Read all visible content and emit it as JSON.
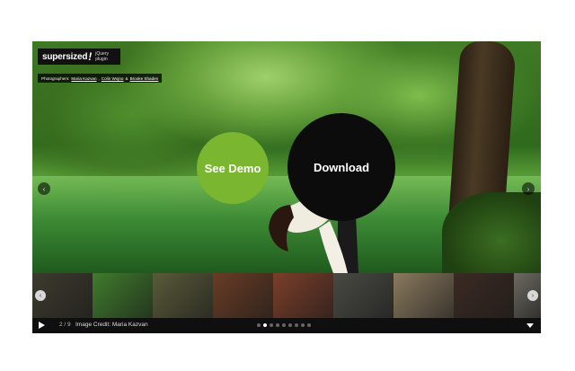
{
  "logo": {
    "name": "supersized",
    "mark": "!",
    "tagline": "jQuery plugin"
  },
  "credits": {
    "prefix": "Photographers:",
    "names": [
      "Maria Kazvan",
      "Colin Wojno",
      "Brooke Shaden"
    ],
    "sep1": ",",
    "sep2": "&"
  },
  "buttons": {
    "demo": "See Demo",
    "download": "Download"
  },
  "arrows": {
    "prev": "‹",
    "next": "›"
  },
  "slides": {
    "current": 2,
    "total": 9,
    "counter": "2 / 9",
    "credit_text": "Image Credit: Maria Kazvan"
  },
  "thumbnails": [
    {
      "name": "thumb-1",
      "color": "#3d3b2e"
    },
    {
      "name": "thumb-2",
      "color": "#3f7c2c"
    },
    {
      "name": "thumb-3",
      "color": "#5a5a3a"
    },
    {
      "name": "thumb-4",
      "color": "#6a3c25"
    },
    {
      "name": "thumb-5",
      "color": "#7c3e2a"
    },
    {
      "name": "thumb-6",
      "color": "#4a4a44"
    },
    {
      "name": "thumb-7",
      "color": "#8a7a5e"
    },
    {
      "name": "thumb-8",
      "color": "#3b2a22"
    },
    {
      "name": "thumb-9",
      "color": "#6c6a60"
    }
  ],
  "pagination_dots": 9,
  "colors": {
    "accent_green": "#7ab62f",
    "download_bg": "#0c0c0c",
    "bar_bg": "#0f0f0f"
  },
  "icons": {
    "play": "play-icon",
    "tray": "tray-toggle-icon",
    "prev": "chevron-left-icon",
    "next": "chevron-right-icon"
  }
}
